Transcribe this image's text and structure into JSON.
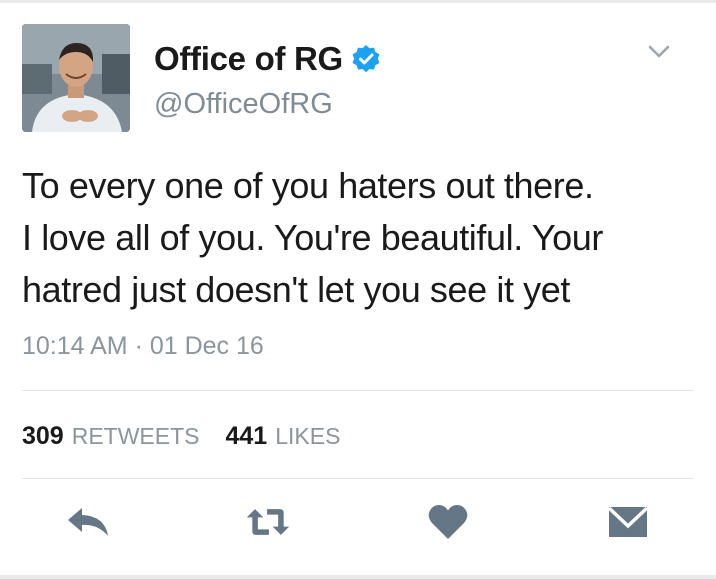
{
  "author": {
    "display_name": "Office of RG",
    "handle": "@OfficeOfRG",
    "verified": true,
    "avatar_icon": "profile-photo"
  },
  "tweet": {
    "lines": [
      "To every one of you haters out there.",
      "I love all of you. You're beautiful. Your",
      "hatred just doesn't let you see it yet"
    ],
    "timestamp": "10:14 AM · 01 Dec 16"
  },
  "stats": {
    "retweets_count": "309",
    "retweets_label": "RETWEETS",
    "likes_count": "441",
    "likes_label": "LIKES"
  },
  "actions": [
    {
      "name": "reply",
      "icon": "reply-icon"
    },
    {
      "name": "retweet",
      "icon": "retweet-icon"
    },
    {
      "name": "like",
      "icon": "heart-icon"
    },
    {
      "name": "message",
      "icon": "envelope-icon"
    }
  ],
  "colors": {
    "text": "#1a1a1a",
    "muted": "#8a959c",
    "icon": "#657786",
    "verified": "#1da1f2"
  }
}
